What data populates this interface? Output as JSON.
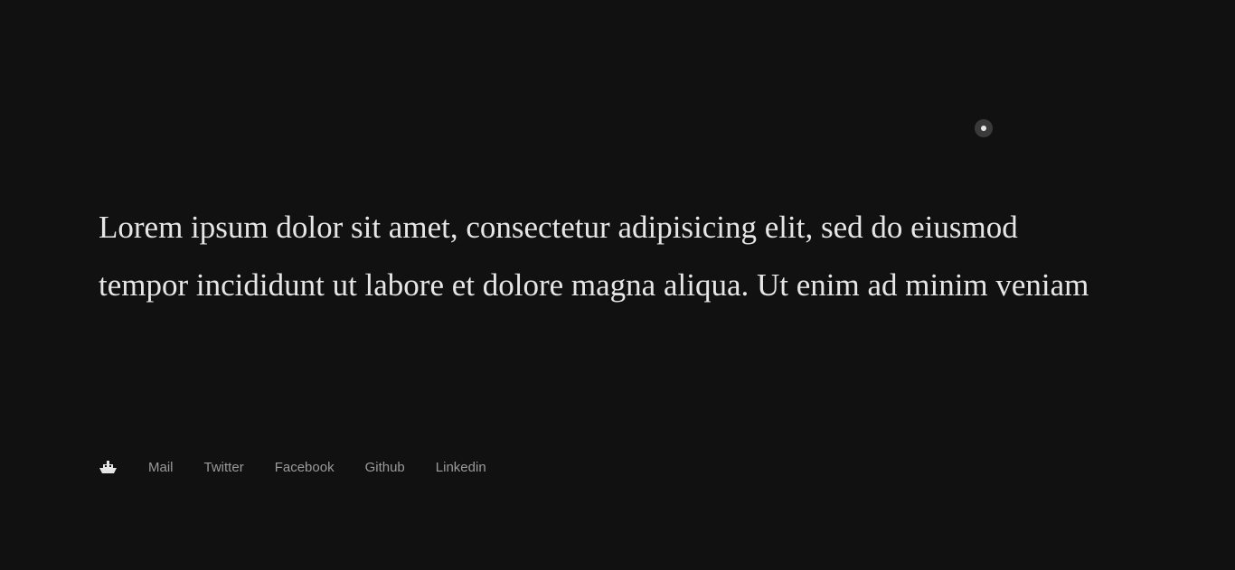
{
  "hero": {
    "text": "Lorem ipsum dolor sit amet, consectetur adipisicing elit, sed do eiusmod tempor incididunt ut labore et dolore magna aliqua. Ut enim ad minim veniam"
  },
  "footer": {
    "logo_icon": "ship-icon",
    "links": [
      {
        "label": "Mail"
      },
      {
        "label": "Twitter"
      },
      {
        "label": "Facebook"
      },
      {
        "label": "Github"
      },
      {
        "label": "Linkedin"
      }
    ]
  },
  "colors": {
    "background": "#111111",
    "text": "#e6e6e6",
    "link": "#9a9a9a",
    "cursor": "#3a3a3a"
  }
}
